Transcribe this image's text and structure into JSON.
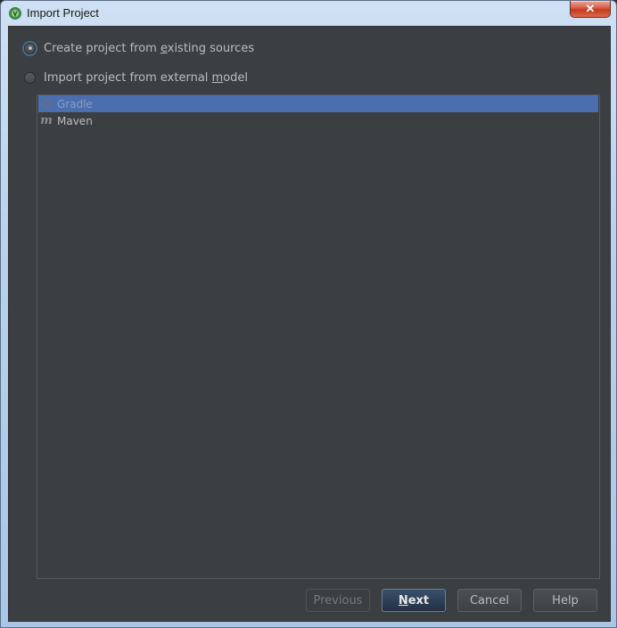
{
  "window": {
    "title": "Import Project",
    "close_glyph": "✕",
    "app_icon": "android-studio-icon"
  },
  "options": {
    "create": {
      "prefix": "Create project from ",
      "mnemonic": "e",
      "suffix": "xisting sources",
      "checked": true
    },
    "import": {
      "prefix": "Import project from external ",
      "mnemonic": "m",
      "suffix": "odel",
      "checked": false
    }
  },
  "model_list": {
    "items": [
      {
        "label": "Gradle",
        "icon": "gradle-icon",
        "selected": true
      },
      {
        "label": "Maven",
        "icon": "maven-icon",
        "selected": false
      }
    ]
  },
  "buttons": {
    "previous": "Previous",
    "next_mnemonic": "N",
    "next_rest": "ext",
    "cancel": "Cancel",
    "help": "Help"
  },
  "colors": {
    "background": "#3c3f41",
    "selection": "#4b6eaf",
    "text": "#bbbbbb"
  }
}
